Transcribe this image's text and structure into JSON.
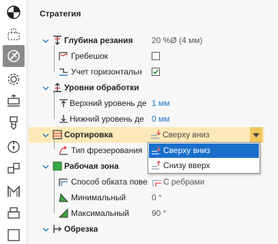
{
  "panel": {
    "title": "Стратегия"
  },
  "rows": {
    "depth": {
      "label": "Глубина резания",
      "value": "20 %Ø (4 мм)"
    },
    "scallop": {
      "label": "Гребешок"
    },
    "horizontal": {
      "label": "Учет горизонтальн"
    },
    "levels": {
      "label": "Уровни обработки"
    },
    "top_level": {
      "label": "Верхний уровень де",
      "value": "1 мм"
    },
    "bottom_level": {
      "label": "Нижний уровень де",
      "value": "0 мм"
    },
    "sorting": {
      "label": "Сортировка",
      "value": "Сверху вниз"
    },
    "milling_type": {
      "label": "Тип фрезерования"
    },
    "work_zone": {
      "label": "Рабочая зона"
    },
    "bypass": {
      "label": "Способ обката пове",
      "value": "С ребрами"
    },
    "min": {
      "label": "Минимальный",
      "value": "0 °"
    },
    "max": {
      "label": "Максимальный",
      "value": "90 °"
    },
    "trim": {
      "label": "Обрезка"
    }
  },
  "dropdown": {
    "options": [
      "Сверху вниз",
      "Снизу вверх"
    ],
    "selected_index": 0
  },
  "checkboxes": {
    "scallop_checked": false,
    "horizontal_checked": true
  },
  "colors": {
    "selected_row": "#fde9b8",
    "highlight": "#1a6fcb",
    "combo_arrow": "#f0c860",
    "value_blue": "#1b78c8"
  },
  "icons": {
    "toolbar": [
      "pie-chart-icon",
      "dashed-box-icon",
      "strategy-icon",
      "gear-icon",
      "stack-icon",
      "cutter-icon",
      "compass-icon",
      "cubes-icon",
      "machine-icon",
      "printer-icon",
      "square-icon"
    ]
  }
}
